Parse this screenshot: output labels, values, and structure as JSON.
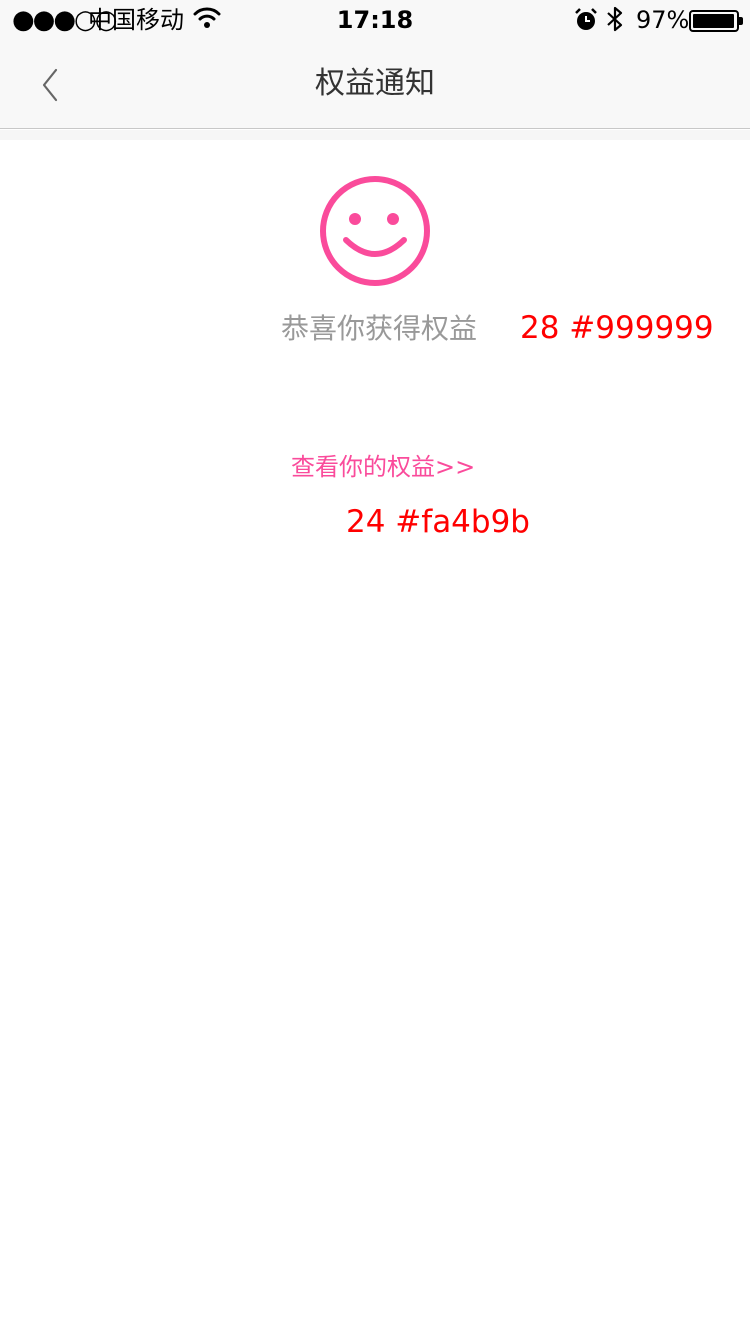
{
  "status_bar": {
    "signal": "●●●○○",
    "carrier": "中国移动",
    "time": "17:18",
    "battery_percent": "97%",
    "battery_level": 0.97,
    "icons": [
      "wifi-icon",
      "alarm-icon",
      "bluetooth-icon",
      "battery-icon"
    ]
  },
  "nav": {
    "title": "权益通知",
    "back_icon": "chevron-left-icon"
  },
  "content": {
    "icon": "smiley-face-icon",
    "message": "恭喜你获得权益",
    "link": "查看你的权益>>"
  },
  "annotations": {
    "message_spec": "28 #999999",
    "link_spec": "24 #fa4b9b"
  },
  "colors": {
    "accent": "#fa4b9b",
    "message_text": "#999999",
    "annotation": "#ff0000",
    "title_text": "#333333"
  }
}
